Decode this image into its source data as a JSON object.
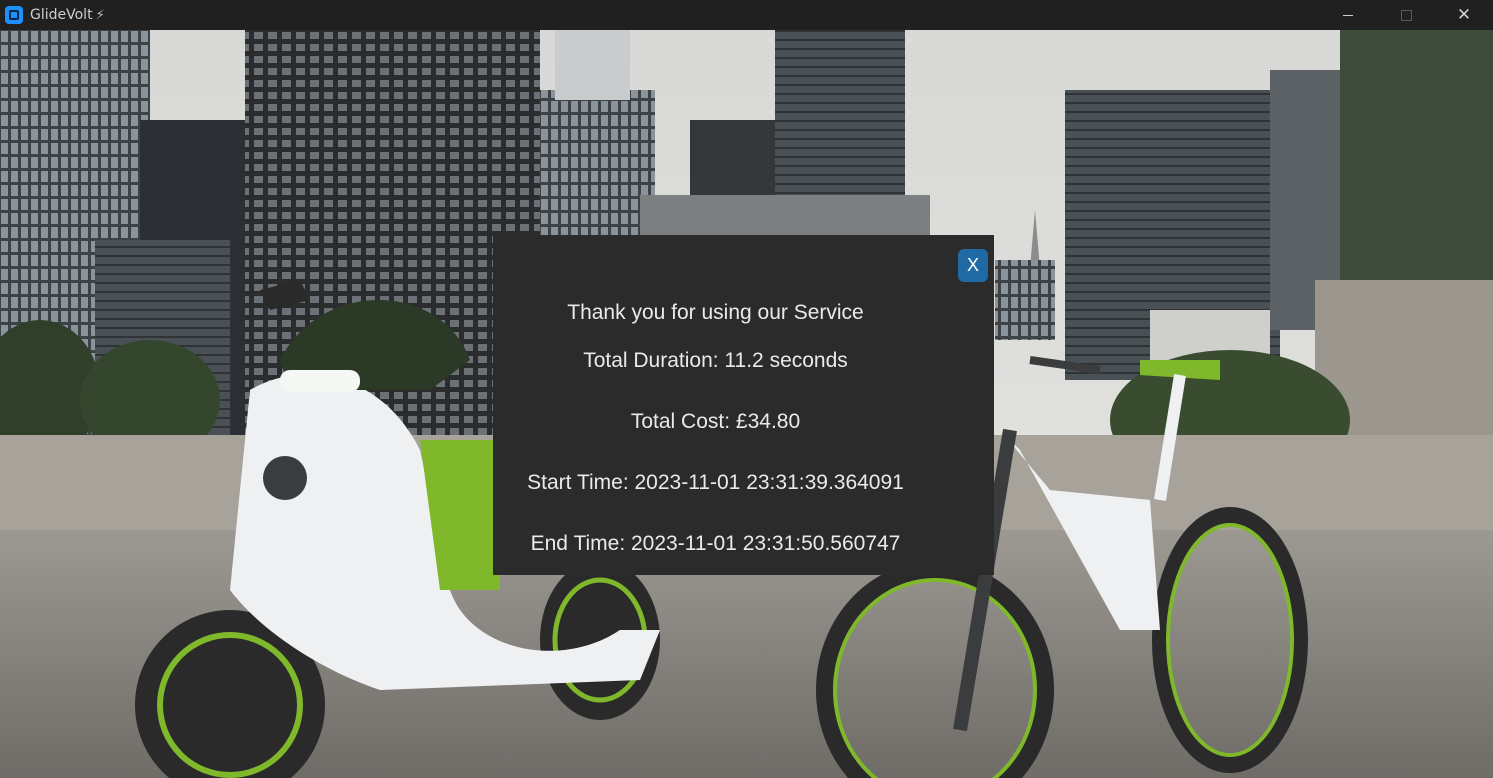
{
  "window": {
    "title": "GlideVolt",
    "title_icon": "bolt-icon",
    "app_icon": "app-logo-icon"
  },
  "dialog": {
    "close_label": "X",
    "thank_you": "Thank you for using our Service",
    "duration": "Total Duration: 11.2 seconds",
    "cost": "Total Cost: £34.80",
    "start_time": "Start Time: 2023-11-01 23:31:39.364091",
    "end_time": "End Time: 2023-11-01 23:31:50.560747"
  },
  "colors": {
    "titlebar": "#202020",
    "dialog_bg": "#2b2b2b",
    "close_button": "#1f6aa5",
    "accent_green": "#7fb82a"
  }
}
